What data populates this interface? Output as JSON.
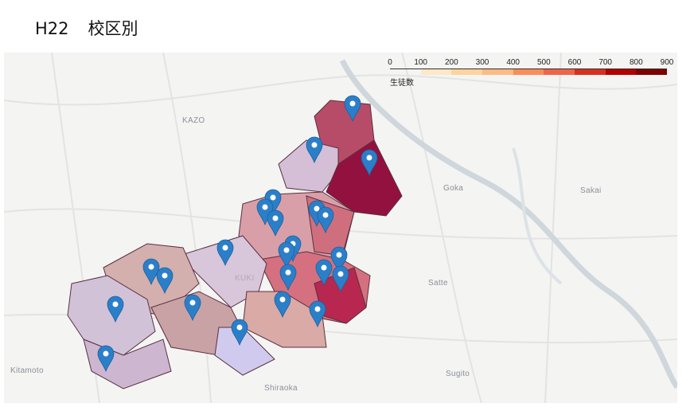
{
  "title": {
    "year": "H22",
    "subtitle": "校区別"
  },
  "legend": {
    "title": "生徒数",
    "ticks": [
      "0",
      "100",
      "200",
      "300",
      "400",
      "500",
      "600",
      "700",
      "800",
      "900"
    ],
    "colors": [
      "#fff5eb",
      "#fee8c8",
      "#fdd49e",
      "#fdbb84",
      "#fc8d59",
      "#ef6548",
      "#d7301f",
      "#b30000",
      "#7f0000"
    ]
  },
  "towns": [
    "KAZO",
    "Goka",
    "Sakai",
    "Satte",
    "Kitamoto",
    "Shiraoka",
    "Sugito",
    "KUKI"
  ],
  "marker_color": "#2b7fc9"
}
